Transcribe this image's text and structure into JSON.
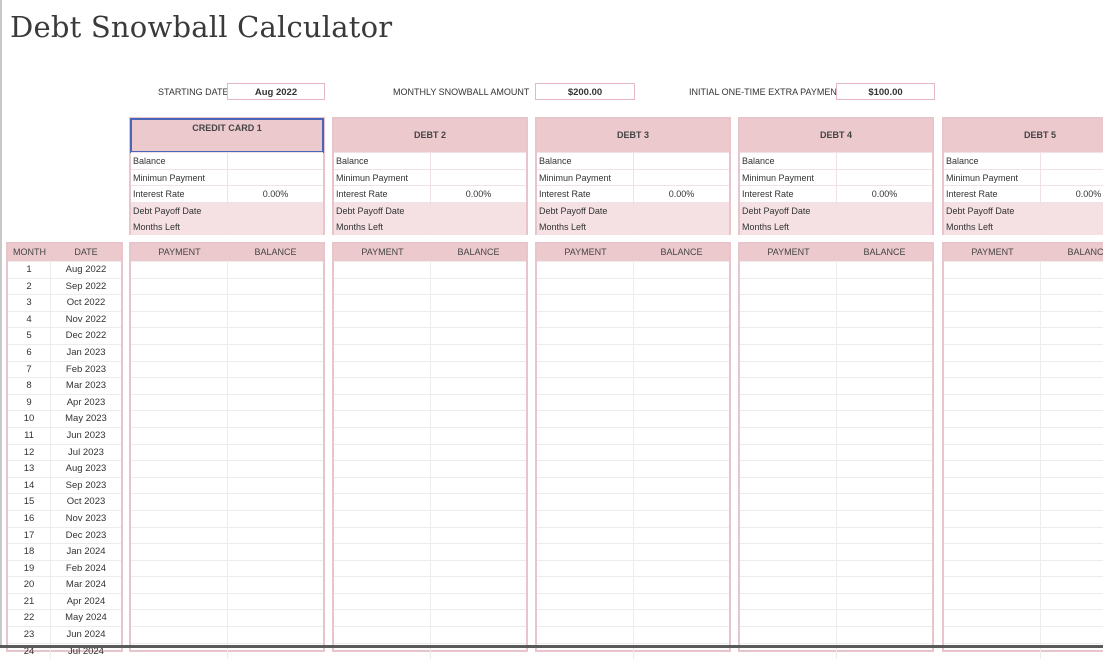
{
  "title": "Debt Snowball Calculator",
  "settings": {
    "starting_date_label": "STARTING DATE",
    "starting_date_value": "Aug 2022",
    "monthly_snowball_label": "MONTHLY SNOWBALL AMOUNT",
    "monthly_snowball_value": "$200.00",
    "extra_payment_label": "INITIAL ONE-TIME EXTRA PAYMENT",
    "extra_payment_value": "$100.00"
  },
  "debts": [
    {
      "name": "CREDIT CARD 1",
      "balance": "",
      "minimum_payment": "",
      "interest_rate": "0.00%",
      "payoff_date": "",
      "months_left": ""
    },
    {
      "name": "DEBT 2",
      "balance": "",
      "minimum_payment": "",
      "interest_rate": "0.00%",
      "payoff_date": "",
      "months_left": ""
    },
    {
      "name": "DEBT 3",
      "balance": "",
      "minimum_payment": "",
      "interest_rate": "0.00%",
      "payoff_date": "",
      "months_left": ""
    },
    {
      "name": "DEBT 4",
      "balance": "",
      "minimum_payment": "",
      "interest_rate": "0.00%",
      "payoff_date": "",
      "months_left": ""
    },
    {
      "name": "DEBT 5",
      "balance": "",
      "minimum_payment": "",
      "interest_rate": "0.00%",
      "payoff_date": "",
      "months_left": ""
    }
  ],
  "card_labels": {
    "balance": "Balance",
    "minimum_payment": "Minimun Payment",
    "interest_rate": "Interest Rate",
    "payoff_date": "Debt Payoff Date",
    "months_left": "Months Left"
  },
  "schedule": {
    "month_header": "MONTH",
    "date_header": "DATE",
    "payment_header": "PAYMENT",
    "balance_header": "BALANCE",
    "rows": [
      {
        "month": "1",
        "date": "Aug 2022"
      },
      {
        "month": "2",
        "date": "Sep 2022"
      },
      {
        "month": "3",
        "date": "Oct 2022"
      },
      {
        "month": "4",
        "date": "Nov 2022"
      },
      {
        "month": "5",
        "date": "Dec 2022"
      },
      {
        "month": "6",
        "date": "Jan 2023"
      },
      {
        "month": "7",
        "date": "Feb 2023"
      },
      {
        "month": "8",
        "date": "Mar 2023"
      },
      {
        "month": "9",
        "date": "Apr 2023"
      },
      {
        "month": "10",
        "date": "May 2023"
      },
      {
        "month": "11",
        "date": "Jun 2023"
      },
      {
        "month": "12",
        "date": "Jul 2023"
      },
      {
        "month": "13",
        "date": "Aug 2023"
      },
      {
        "month": "14",
        "date": "Sep 2023"
      },
      {
        "month": "15",
        "date": "Oct 2023"
      },
      {
        "month": "16",
        "date": "Nov 2023"
      },
      {
        "month": "17",
        "date": "Dec 2023"
      },
      {
        "month": "18",
        "date": "Jan 2024"
      },
      {
        "month": "19",
        "date": "Feb 2024"
      },
      {
        "month": "20",
        "date": "Mar 2024"
      },
      {
        "month": "21",
        "date": "Apr 2024"
      },
      {
        "month": "22",
        "date": "May 2024"
      },
      {
        "month": "23",
        "date": "Jun 2024"
      },
      {
        "month": "24",
        "date": "Jul 2024"
      }
    ]
  }
}
